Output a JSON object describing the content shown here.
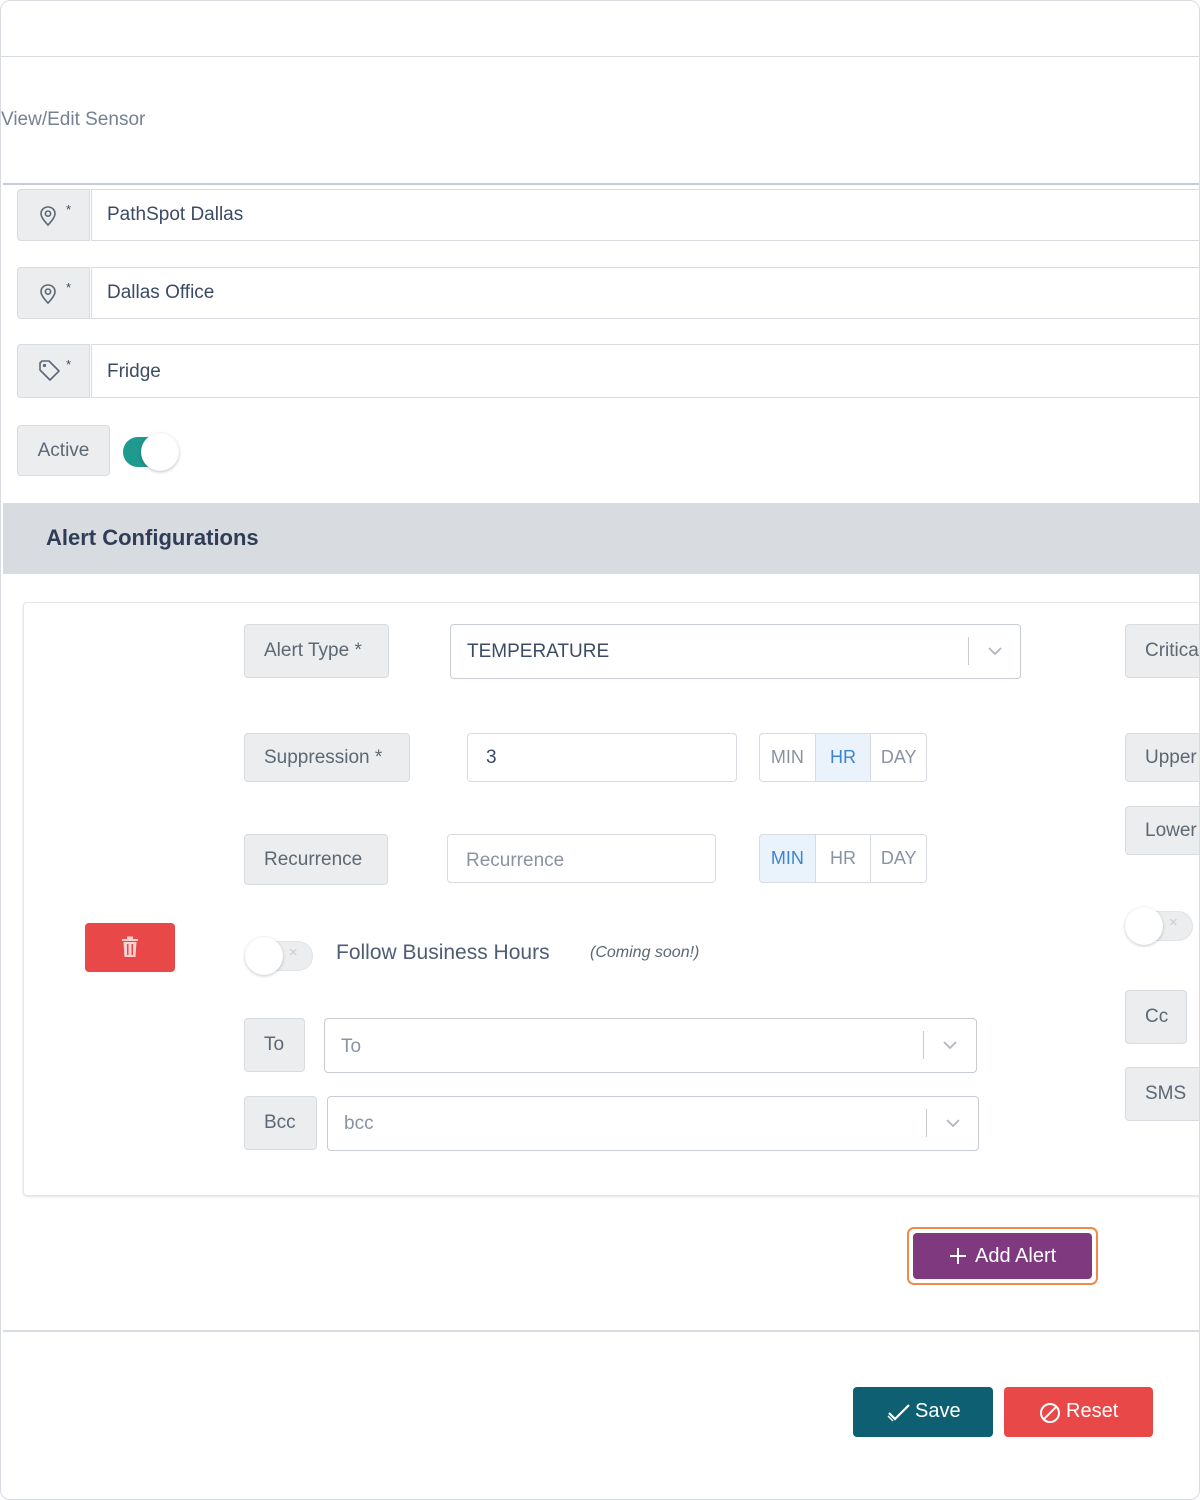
{
  "page": {
    "title": "View/Edit Sensor"
  },
  "sensor": {
    "location_value": "PathSpot Dallas",
    "sublocation_value": "Dallas Office",
    "name_value": "Fridge",
    "required_mark": "*",
    "active_label": "Active",
    "active": true
  },
  "alerts_section": {
    "title": "Alert Configurations"
  },
  "alert": {
    "alert_type_label": "Alert Type *",
    "alert_type_value": "TEMPERATURE",
    "suppression_label": "Suppression *",
    "suppression_value": "3",
    "suppression_units": [
      "MIN",
      "HR",
      "DAY"
    ],
    "suppression_selected": "HR",
    "recurrence_label": "Recurrence",
    "recurrence_placeholder": "Recurrence",
    "recurrence_units": [
      "MIN",
      "HR",
      "DAY"
    ],
    "recurrence_selected": "MIN",
    "follow_business_hours_label": "Follow Business Hours",
    "coming_soon": "(Coming soon!)",
    "to_label": "To",
    "to_placeholder": "To",
    "bcc_label": "Bcc",
    "bcc_placeholder": "bcc",
    "critical_label": "Critica",
    "upper_label": "Upper",
    "lower_label": "Lower",
    "cc_label": "Cc",
    "sms_label": "SMS",
    "toggle_off_glyph": "×"
  },
  "actions": {
    "add_alert": "Add Alert",
    "save": "Save",
    "reset": "Reset"
  },
  "colors": {
    "accent_teal": "#1f9a8e",
    "add_alert": "#7f3a7f",
    "save": "#0f5f73",
    "danger": "#e84848",
    "focus_ring": "#f08a4b"
  }
}
